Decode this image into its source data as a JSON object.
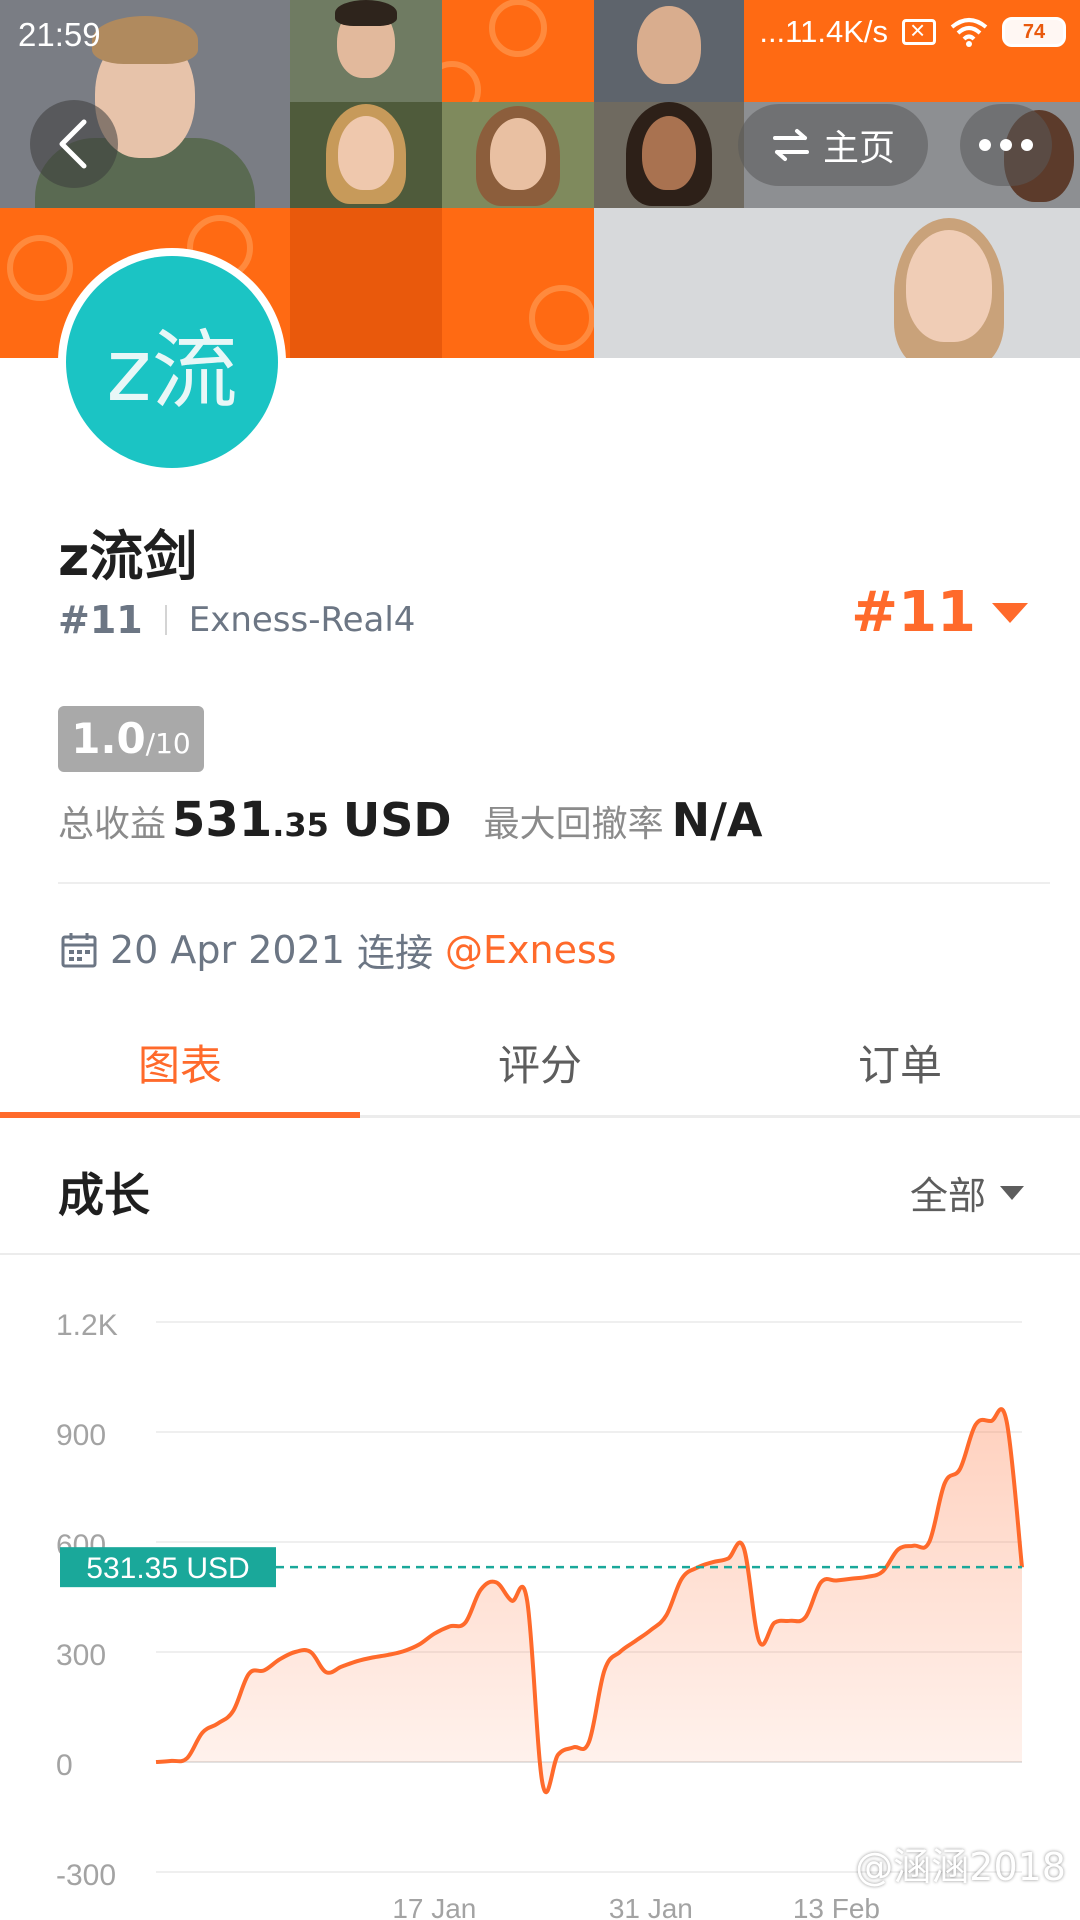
{
  "status_bar": {
    "time": "21:59",
    "network_speed": "...11.4K/s",
    "battery": "74"
  },
  "header": {
    "home_label": "主页",
    "back_icon": "chevron-left-icon",
    "swap_icon": "swap-arrows-icon",
    "more_icon": "more-dots-icon"
  },
  "profile": {
    "avatar_text": "z流",
    "name": "z流剑",
    "rank": "#11",
    "server": "Exness-Real4",
    "rank_badge": "#11",
    "score": "1.0",
    "score_max": "/10",
    "total_profit_label": "总收益",
    "total_profit_int": "531",
    "total_profit_dec": ".35",
    "total_profit_unit": "USD",
    "max_drawdown_label": "最大回撤率",
    "max_drawdown_value": "N/A",
    "connected_date": "20 Apr 2021",
    "connected_label": "连接",
    "connected_broker": "@Exness"
  },
  "tabs": [
    {
      "label": "图表",
      "active": true
    },
    {
      "label": "评分",
      "active": false
    },
    {
      "label": "订单",
      "active": false
    }
  ],
  "growth": {
    "title": "成长",
    "range_label": "全部"
  },
  "colors": {
    "accent": "#ff6a2b",
    "banner": "#ff6a13",
    "avatar": "#1bc4c4",
    "current_line": "#1aa89a"
  },
  "chart_data": {
    "type": "area",
    "ylim": [
      -300,
      1200
    ],
    "y_ticks": [
      "1.2K",
      "900",
      "600",
      "300",
      "0",
      "-300"
    ],
    "y_tick_values": [
      1200,
      900,
      600,
      300,
      0,
      -300
    ],
    "x_ticks": [
      "17 Jan",
      "31 Jan",
      "13 Feb"
    ],
    "x_tick_index": [
      18,
      32,
      44
    ],
    "current_value": 531.35,
    "current_label": "531.35 USD",
    "series": [
      {
        "values": [
          0,
          3,
          10,
          80,
          105,
          140,
          240,
          250,
          280,
          300,
          300,
          245,
          260,
          275,
          285,
          292,
          302,
          320,
          350,
          370,
          380,
          470,
          490,
          440,
          440,
          -60,
          20,
          40,
          55,
          250,
          300,
          330,
          360,
          400,
          500,
          530,
          545,
          555,
          585,
          330,
          380,
          385,
          395,
          490,
          495,
          500,
          505,
          520,
          580,
          590,
          600,
          760,
          800,
          920,
          930,
          930,
          531
        ]
      }
    ]
  },
  "watermark": "@涵涵2018"
}
